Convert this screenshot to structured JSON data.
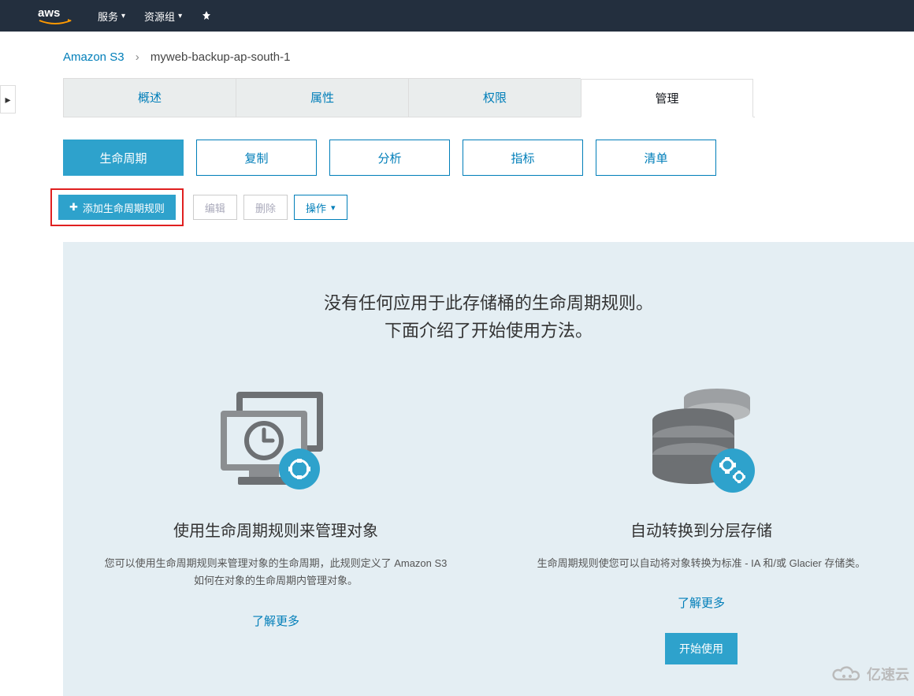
{
  "topnav": {
    "services_label": "服务",
    "resource_groups_label": "资源组"
  },
  "breadcrumb": {
    "root": "Amazon S3",
    "current": "myweb-backup-ap-south-1"
  },
  "tabs": {
    "overview": "概述",
    "properties": "属性",
    "permissions": "权限",
    "management": "管理"
  },
  "subtabs": {
    "lifecycle": "生命周期",
    "replication": "复制",
    "analytics": "分析",
    "metrics": "指标",
    "inventory": "清单"
  },
  "actions": {
    "add_rule": "添加生命周期规则",
    "edit": "编辑",
    "delete": "删除",
    "operations": "操作"
  },
  "empty_state": {
    "heading_line1": "没有任何应用于此存储桶的生命周期规则。",
    "heading_line2": "下面介绍了开始使用方法。",
    "card1": {
      "title": "使用生命周期规则来管理对象",
      "desc": "您可以使用生命周期规则来管理对象的生命周期，此规则定义了 Amazon S3 如何在对象的生命周期内管理对象。",
      "learn_more": "了解更多"
    },
    "card2": {
      "title": "自动转换到分层存储",
      "desc": "生命周期规则使您可以自动将对象转换为标准 - IA 和/或 Glacier 存储类。",
      "learn_more": "了解更多",
      "start": "开始使用"
    }
  },
  "watermark": "亿速云"
}
